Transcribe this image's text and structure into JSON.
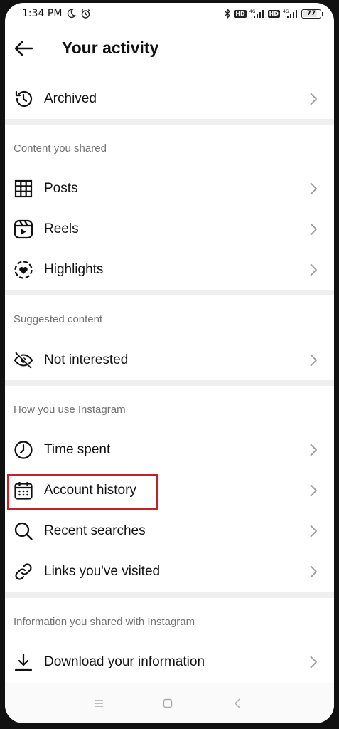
{
  "status_bar": {
    "time": "1:34 PM",
    "battery": "77",
    "icons": [
      "moon-icon",
      "alarm-icon",
      "bluetooth-icon",
      "hd-icon",
      "signal-4g-icon",
      "hd-icon",
      "signal-4g-icon",
      "battery-icon"
    ],
    "hd_label": "HD",
    "net_label": "4G"
  },
  "header": {
    "title": "Your activity",
    "back_icon": "arrow-left-icon"
  },
  "archived": {
    "label": "Archived",
    "icon": "archive-history-icon"
  },
  "sections": {
    "content_shared": {
      "title": "Content you shared",
      "items": [
        {
          "label": "Posts",
          "icon": "grid-icon"
        },
        {
          "label": "Reels",
          "icon": "reels-icon"
        },
        {
          "label": "Highlights",
          "icon": "highlights-icon"
        }
      ]
    },
    "suggested": {
      "title": "Suggested content",
      "items": [
        {
          "label": "Not interested",
          "icon": "eye-off-icon"
        }
      ]
    },
    "how_use": {
      "title": "How you use Instagram",
      "items": [
        {
          "label": "Time spent",
          "icon": "clock-icon"
        },
        {
          "label": "Account history",
          "icon": "calendar-icon"
        },
        {
          "label": "Recent searches",
          "icon": "search-icon"
        },
        {
          "label": "Links you've visited",
          "icon": "link-icon"
        }
      ]
    },
    "info_shared": {
      "title": "Information you shared with Instagram",
      "items": [
        {
          "label": "Download your information",
          "icon": "download-icon"
        }
      ]
    }
  },
  "colors": {
    "highlight": "#c8202a",
    "section_gap": "#efefef",
    "muted_text": "#737373"
  },
  "nav": [
    "menu-icon",
    "home-square-icon",
    "back-chevron-icon"
  ]
}
